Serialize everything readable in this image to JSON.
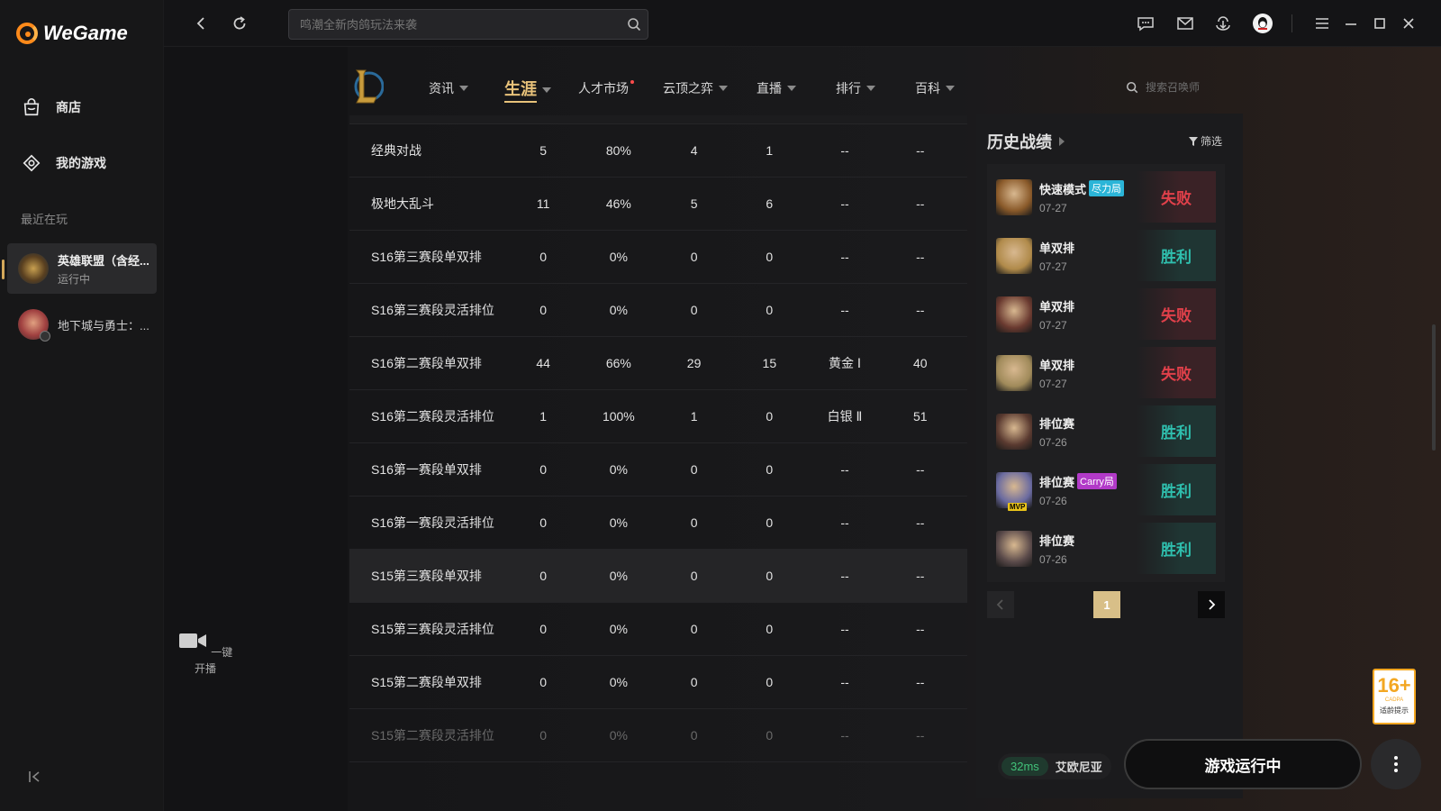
{
  "app": {
    "name": "WeGame"
  },
  "sidebar": {
    "nav": [
      {
        "label": "商店",
        "icon": "shop-bag-icon"
      },
      {
        "label": "我的游戏",
        "icon": "my-games-icon"
      }
    ],
    "recent_label": "最近在玩",
    "games": [
      {
        "name": "英雄联盟（含经...",
        "status": "运行中",
        "active": true
      },
      {
        "name": "地下城与勇士：...",
        "status": "",
        "active": false
      }
    ]
  },
  "titlebar": {
    "search_placeholder": "鸣潮全新肉鸽玩法来袭"
  },
  "stream": {
    "label": "一键开播"
  },
  "game_nav": {
    "items": [
      {
        "label": "资讯",
        "caret": true
      },
      {
        "label": "生涯",
        "caret": true,
        "active": true
      },
      {
        "label": "人才市场",
        "dot": true
      },
      {
        "label": "云顶之弈",
        "caret": true
      },
      {
        "label": "直播",
        "caret": true
      },
      {
        "label": "排行",
        "caret": true
      },
      {
        "label": "百科",
        "caret": true
      }
    ],
    "search_placeholder": "搜索召唤师"
  },
  "table": {
    "rows": [
      [
        "经典对战",
        "5",
        "80%",
        "4",
        "1",
        "--",
        "--"
      ],
      [
        "极地大乱斗",
        "11",
        "46%",
        "5",
        "6",
        "--",
        "--"
      ],
      [
        "S16第三赛段单双排",
        "0",
        "0%",
        "0",
        "0",
        "--",
        "--"
      ],
      [
        "S16第三赛段灵活排位",
        "0",
        "0%",
        "0",
        "0",
        "--",
        "--"
      ],
      [
        "S16第二赛段单双排",
        "44",
        "66%",
        "29",
        "15",
        "黄金 Ⅰ",
        "40"
      ],
      [
        "S16第二赛段灵活排位",
        "1",
        "100%",
        "1",
        "0",
        "白银 Ⅱ",
        "51"
      ],
      [
        "S16第一赛段单双排",
        "0",
        "0%",
        "0",
        "0",
        "--",
        "--"
      ],
      [
        "S16第一赛段灵活排位",
        "0",
        "0%",
        "0",
        "0",
        "--",
        "--"
      ],
      [
        "S15第三赛段单双排",
        "0",
        "0%",
        "0",
        "0",
        "--",
        "--"
      ],
      [
        "S15第三赛段灵活排位",
        "0",
        "0%",
        "0",
        "0",
        "--",
        "--"
      ],
      [
        "S15第二赛段单双排",
        "0",
        "0%",
        "0",
        "0",
        "--",
        "--"
      ],
      [
        "S15第二赛段灵活排位",
        "0",
        "0%",
        "0",
        "0",
        "--",
        "--"
      ]
    ],
    "highlighted_row": 8
  },
  "history": {
    "title": "历史战绩",
    "filter_label": "筛选",
    "matches": [
      {
        "mode": "快速模式",
        "tag": "尽力局",
        "tag_color": "#2bb5d8",
        "date": "07-27",
        "result": "失败",
        "win": false,
        "avatar_color": "#8a5a2a"
      },
      {
        "mode": "单双排",
        "tag": "",
        "date": "07-27",
        "result": "胜利",
        "win": true,
        "avatar_color": "#b08a4a"
      },
      {
        "mode": "单双排",
        "tag": "",
        "date": "07-27",
        "result": "失败",
        "win": false,
        "avatar_color": "#6a3a30"
      },
      {
        "mode": "单双排",
        "tag": "",
        "date": "07-27",
        "result": "失败",
        "win": false,
        "avatar_color": "#a08a5a"
      },
      {
        "mode": "排位赛",
        "tag": "",
        "date": "07-26",
        "result": "胜利",
        "win": true,
        "avatar_color": "#5a3a30"
      },
      {
        "mode": "排位赛",
        "tag": "Carry局",
        "tag_color": "#b23ac8",
        "date": "07-26",
        "result": "胜利",
        "win": true,
        "avatar_color": "#6a6aa0",
        "mvp": "MVP"
      },
      {
        "mode": "排位赛",
        "tag": "",
        "date": "07-26",
        "result": "胜利",
        "win": true,
        "avatar_color": "#5a4a4a"
      }
    ],
    "page": "1"
  },
  "bottom": {
    "ping": "32ms",
    "server": "艾欧尼亚",
    "run_label": "游戏运行中"
  },
  "age_badge": {
    "number": "16+",
    "sub": "CADPA",
    "tip": "适龄提示"
  }
}
